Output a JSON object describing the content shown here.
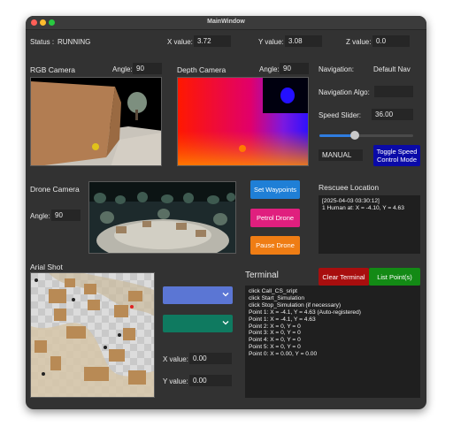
{
  "window": {
    "title": "MainWindow"
  },
  "status": {
    "label": "Status :",
    "value": "RUNNING"
  },
  "position": {
    "x_label": "X value:",
    "x_value": "3.72",
    "y_label": "Y value:",
    "y_value": "3.08",
    "z_label": "Z value:",
    "z_value": "0.0"
  },
  "rgb_camera": {
    "title": "RGB Camera",
    "angle_label": "Angle:",
    "angle_value": "90"
  },
  "depth_camera": {
    "title": "Depth Camera",
    "angle_label": "Angle:",
    "angle_value": "90"
  },
  "navigation": {
    "label": "Navigation:",
    "value": "Default Nav",
    "algo_label": "Navigation Algo:",
    "algo_value": "",
    "speed_label": "Speed Slider:",
    "speed_value": "36.00",
    "speed_level": 0.36,
    "mode_value": "MANUAL",
    "toggle_label_line1": "Toggle Speed",
    "toggle_label_line2": "Control Mode"
  },
  "drone_camera": {
    "title": "Drone Camera",
    "angle_label": "Angle:",
    "angle_value": "90"
  },
  "actions": {
    "set_waypoints": "Set Waypoints",
    "petrol_drone": "Petrol Drone",
    "pause_drone": "Pause Drone"
  },
  "rescuee": {
    "title": "Rescuee Location",
    "lines": [
      "[2025-04-03 03:30:12]",
      "1 Human at: X = -4.10, Y = 4.63"
    ]
  },
  "aerial": {
    "title": "Arial Shot",
    "x_label": "X value:",
    "x_value": "0.00",
    "y_label": "Y value:",
    "y_value": "0.00"
  },
  "terminal": {
    "title": "Terminal",
    "clear_label": "Clear Terminal",
    "list_label": "List Point(s)",
    "lines": [
      "click Call_CS_sript",
      "click Start_Simulation",
      "click Stop_Simulation (if necessary)",
      "Point 1: X = -4.1, Y = 4.63 (Auto-registered)",
      "Point 1: X = -4.1, Y = 4.63",
      "Point 2: X = 0, Y = 0",
      "Point 3: X = 0, Y = 0",
      "Point 4: X = 0, Y = 0",
      "Point 5: X = 0, Y = 0",
      "Point 0: X = 0.00, Y = 0.00"
    ]
  },
  "colors": {
    "waypoints_button": "#1f7fd6",
    "petrol_button": "#e01f7e",
    "pause_button": "#ef7d14",
    "toggle_button": "#0a0aa8",
    "clear_button": "#a80e0e",
    "list_button": "#138a15",
    "dropdown_blue": "#5b76d4",
    "dropdown_green": "#0f7a60"
  },
  "icons": {
    "dropdown_chevron": "chevron-down-icon"
  }
}
